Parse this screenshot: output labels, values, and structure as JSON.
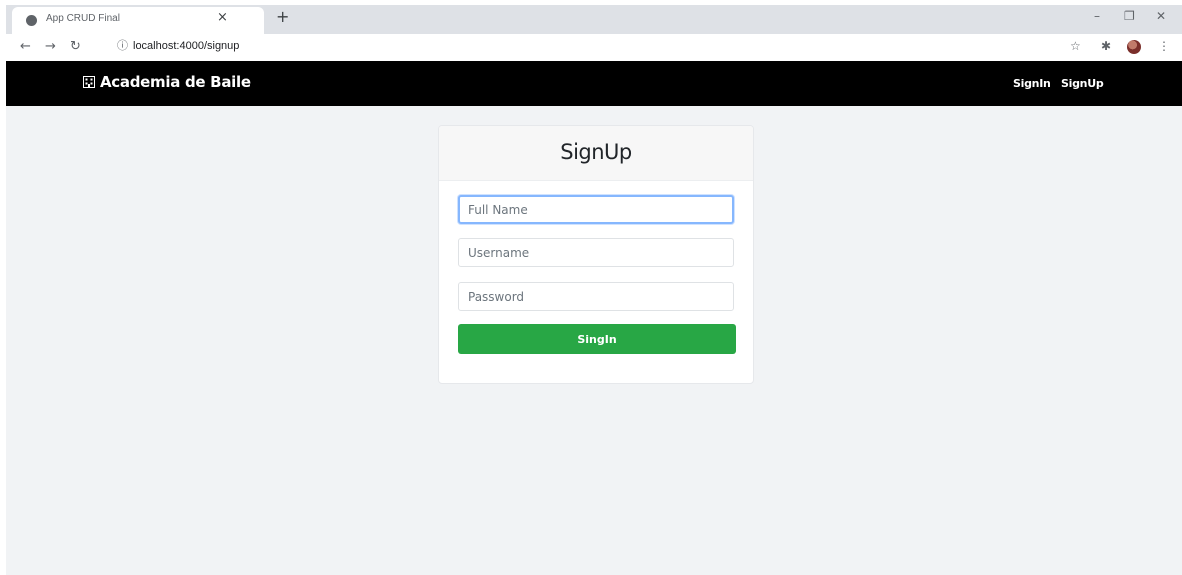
{
  "browser": {
    "tab_title": "App CRUD Final",
    "tab_close": "×",
    "new_tab": "+",
    "url": "localhost:4000/signup",
    "window_controls": {
      "minimize": "–",
      "restore": "❐",
      "close": "✕"
    },
    "icons": [
      "back-arrow-icon",
      "forward-arrow-icon",
      "reload-icon",
      "info-icon",
      "star-icon",
      "extensions-icon",
      "profile-avatar",
      "menu-dots-icon"
    ]
  },
  "navbar": {
    "brand": "Academia de Baile",
    "links": [
      "SignIn",
      "SignUp"
    ],
    "background": "#000000"
  },
  "form": {
    "title": "SignUp",
    "fields": {
      "fullname_placeholder": "Full Name",
      "username_placeholder": "Username",
      "password_placeholder": "Password"
    },
    "submit_label": "SingIn",
    "submit_color": "#28a745"
  }
}
